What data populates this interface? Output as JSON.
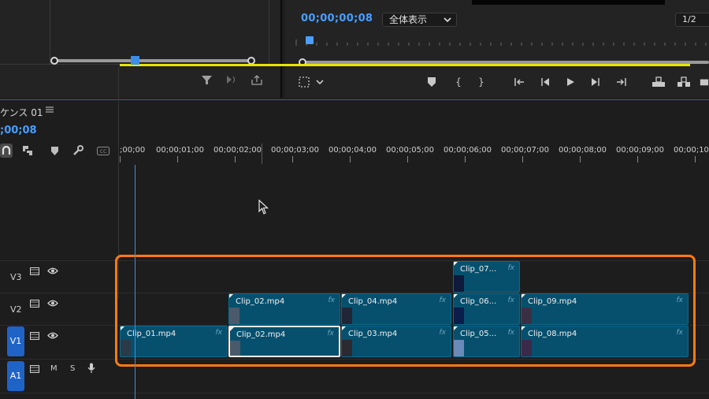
{
  "program_monitor": {
    "timecode": "00;00;00;08",
    "fit_option": "全体表示",
    "resolution": "1/2"
  },
  "sequence": {
    "tab_label": "ケンス 01",
    "timecode": ";00;08"
  },
  "ruler": {
    "labels": [
      ";00;00",
      "00;00;01;00",
      "00;00;02;00",
      "00;00;03;00",
      "00;00;04;00",
      "00;00;05;00",
      "00;00;06;00",
      "00;00;07;00",
      "00;00;08;00",
      "00;00;09;00",
      "00;00;10;0"
    ]
  },
  "tracks": {
    "v3": "V3",
    "v2": "V2",
    "v1": "V1",
    "a1": "A1",
    "mute": "M",
    "solo": "S"
  },
  "clips": {
    "v3": [
      {
        "name": "Clip_07..."
      }
    ],
    "v2": [
      {
        "name": "Clip_02.mp4"
      },
      {
        "name": "Clip_04.mp4"
      },
      {
        "name": "Clip_06..."
      },
      {
        "name": "Clip_09.mp4"
      }
    ],
    "v1": [
      {
        "name": "Clip_01.mp4"
      },
      {
        "name": "Clip_02.mp4"
      },
      {
        "name": "Clip_03.mp4"
      },
      {
        "name": "Clip_05..."
      },
      {
        "name": "Clip_08.mp4"
      }
    ],
    "fx_label": "fx"
  },
  "colors": {
    "accent": "#4a9eff",
    "clip": "#06506e",
    "highlight": "#ff7a12",
    "work_area": "#e6e600"
  }
}
